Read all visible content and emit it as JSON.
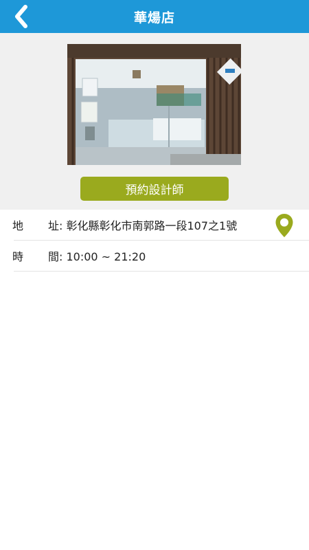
{
  "header": {
    "title": "華煬店",
    "back_icon": "chevron-left-icon"
  },
  "hero": {
    "cta_label": "預約設計師"
  },
  "info": {
    "address": {
      "label_char1": "地",
      "label_rest": "址: 彰化縣彰化市南郭路一段107之1號",
      "icon": "map-pin-icon"
    },
    "hours": {
      "label_char1": "時",
      "label_rest": "間: 10:00 ~ 21:20"
    }
  },
  "colors": {
    "nav": "#1e98d8",
    "accent": "#9aaa1e"
  }
}
